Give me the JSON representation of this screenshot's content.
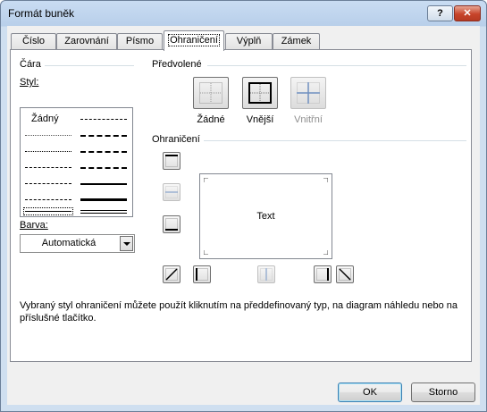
{
  "window": {
    "title": "Formát buněk",
    "help_label": "?",
    "close_label": "✕"
  },
  "tabs": [
    {
      "label": "Číslo",
      "active": false
    },
    {
      "label": "Zarovnání",
      "active": false
    },
    {
      "label": "Písmo",
      "active": false
    },
    {
      "label": "Ohraničení",
      "active": true
    },
    {
      "label": "Výplň",
      "active": false
    },
    {
      "label": "Zámek",
      "active": false
    }
  ],
  "line_group": {
    "title": "Čára",
    "style_label": "Styl:",
    "none_style": "Žádný",
    "color_label": "Barva:",
    "color_value": "Automatická"
  },
  "presets": {
    "title": "Předvolené",
    "none": "Žádné",
    "outline": "Vnější",
    "inside": "Vnitřní"
  },
  "border": {
    "title": "Ohraničení",
    "preview_text": "Text"
  },
  "description": "Vybraný styl ohraničení můžete použít kliknutím na předdefinovaný typ, na diagram náhledu nebo na příslušné tlačítko.",
  "buttons": {
    "ok": "OK",
    "cancel": "Storno"
  }
}
